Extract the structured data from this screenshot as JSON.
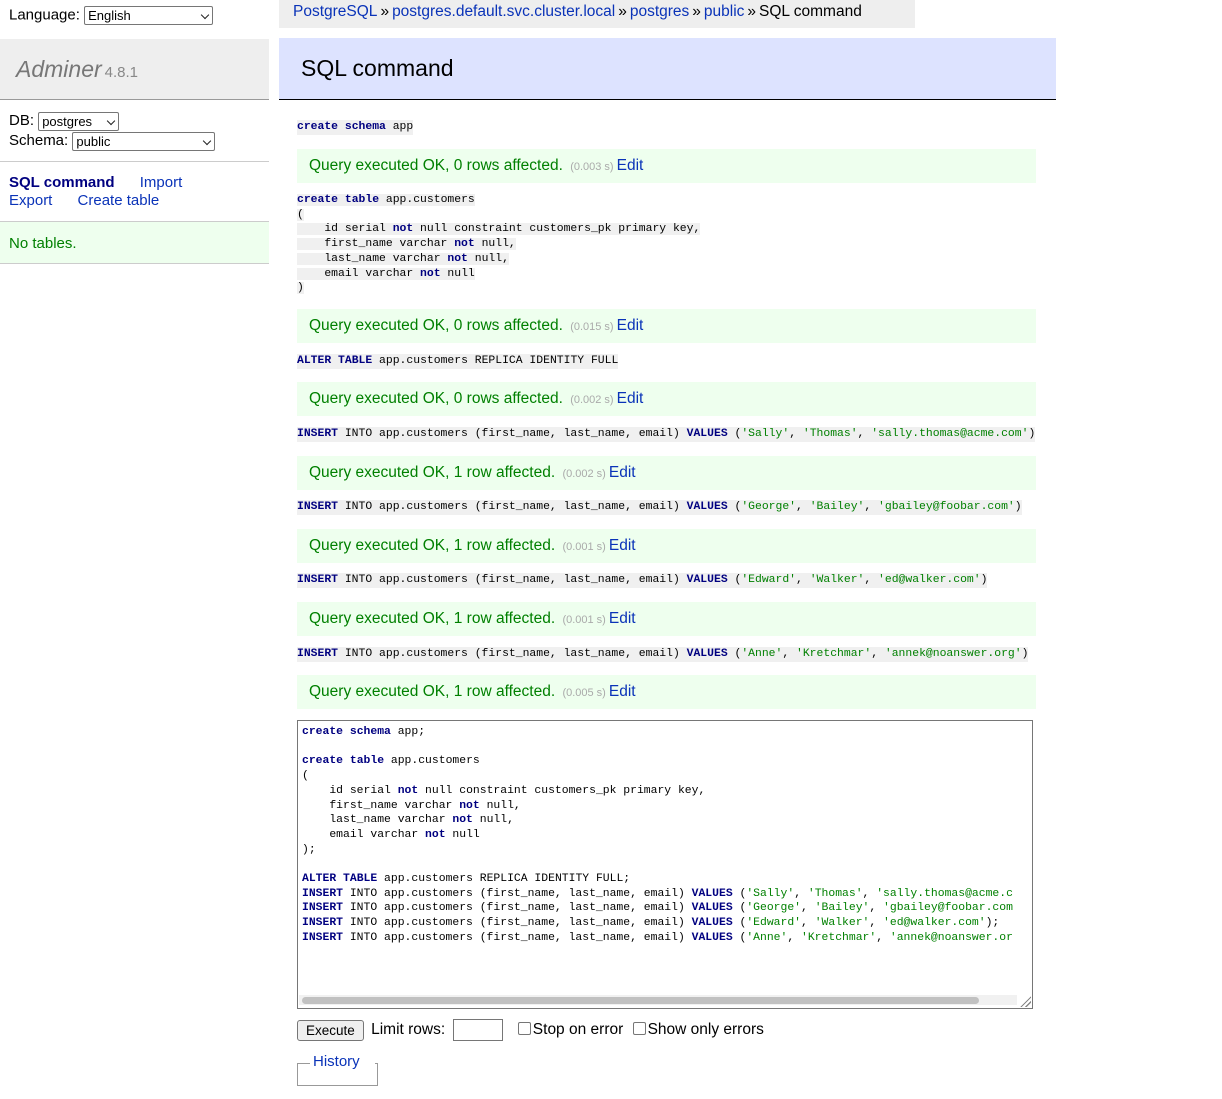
{
  "language": {
    "label": "Language:",
    "value": "English"
  },
  "brand": {
    "name": "Adminer",
    "version": "4.8.1"
  },
  "db_select": {
    "label": "DB:",
    "value": "postgres"
  },
  "schema_select": {
    "label": "Schema:",
    "value": "public"
  },
  "menu": {
    "sql_command": "SQL command",
    "import": "Import",
    "export": "Export",
    "create_table": "Create table",
    "no_tables": "No tables."
  },
  "breadcrumb": {
    "system": "PostgreSQL",
    "server": "postgres.default.svc.cluster.local",
    "database": "postgres",
    "schema": "public",
    "current": "SQL command",
    "separator": "»"
  },
  "page_title": "SQL command",
  "results": [
    {
      "query": "create schema app",
      "message": "Query executed OK, 0 rows affected.",
      "time": "(0.003 s)",
      "edit": "Edit"
    },
    {
      "query": "create table app.customers ( id serial not null constraint customers_pk primary key, first_name varchar not null, last_name varchar not null, email varchar not null )",
      "message": "Query executed OK, 0 rows affected.",
      "time": "(0.015 s)",
      "edit": "Edit"
    },
    {
      "query": "ALTER TABLE app.customers REPLICA IDENTITY FULL",
      "message": "Query executed OK, 0 rows affected.",
      "time": "(0.002 s)",
      "edit": "Edit"
    },
    {
      "query": "INSERT INTO app.customers (first_name, last_name, email) VALUES ('Sally', 'Thomas', 'sally.thomas@acme.com')",
      "message": "Query executed OK, 1 row affected.",
      "time": "(0.002 s)",
      "edit": "Edit"
    },
    {
      "query": "INSERT INTO app.customers (first_name, last_name, email) VALUES ('George', 'Bailey', 'gbailey@foobar.com')",
      "message": "Query executed OK, 1 row affected.",
      "time": "(0.001 s)",
      "edit": "Edit"
    },
    {
      "query": "INSERT INTO app.customers (first_name, last_name, email) VALUES ('Edward', 'Walker', 'ed@walker.com')",
      "message": "Query executed OK, 1 row affected.",
      "time": "(0.001 s)",
      "edit": "Edit"
    },
    {
      "query": "INSERT INTO app.customers (first_name, last_name, email) VALUES ('Anne', 'Kretchmar', 'annek@noanswer.org')",
      "message": "Query executed OK, 1 row affected.",
      "time": "(0.005 s)",
      "edit": "Edit"
    }
  ],
  "editor": {
    "lines": [
      "create schema app;",
      "",
      "create table app.customers",
      "(",
      "    id serial not null constraint customers_pk primary key,",
      "    first_name varchar not null,",
      "    last_name varchar not null,",
      "    email varchar not null",
      ");",
      "",
      "ALTER TABLE app.customers REPLICA IDENTITY FULL;",
      "INSERT INTO app.customers (first_name, last_name, email) VALUES ('Sally', 'Thomas', 'sally.thomas@acme.c",
      "INSERT INTO app.customers (first_name, last_name, email) VALUES ('George', 'Bailey', 'gbailey@foobar.com",
      "INSERT INTO app.customers (first_name, last_name, email) VALUES ('Edward', 'Walker', 'ed@walker.com');",
      "INSERT INTO app.customers (first_name, last_name, email) VALUES ('Anne', 'Kretchmar', 'annek@noanswer.or"
    ]
  },
  "controls": {
    "execute": "Execute",
    "limit_rows": "Limit rows:",
    "limit_value": "",
    "stop_on_error": "Stop on error",
    "show_only_errors": "Show only errors"
  },
  "history": {
    "label": "History"
  },
  "colors": {
    "keyword": "#000080",
    "string": "#008000",
    "header_bg": "#dde3ff",
    "success_bg": "#eeffee",
    "link": "#0a33b8"
  }
}
